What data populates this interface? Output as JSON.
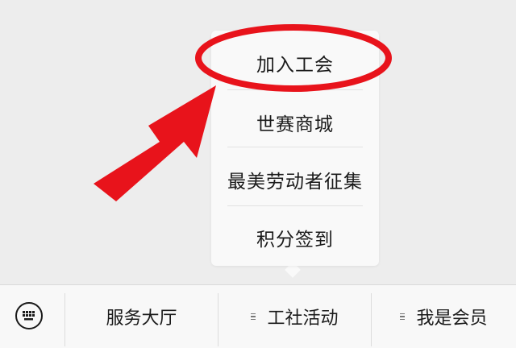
{
  "popup_menu": {
    "items": [
      {
        "label": "加入工会"
      },
      {
        "label": "世赛商城"
      },
      {
        "label": "最美劳动者征集"
      },
      {
        "label": "积分签到"
      }
    ]
  },
  "bottom_bar": {
    "keyboard_icon": "keyboard-icon",
    "tabs": [
      {
        "label": "服务大厅",
        "has_menu_icon": false
      },
      {
        "label": "工社活动",
        "has_menu_icon": true
      },
      {
        "label": "我是会员",
        "has_menu_icon": true
      }
    ]
  },
  "annotation": {
    "color": "#e8131b",
    "highlighted_item": "加入工会"
  },
  "colors": {
    "background": "#ededed",
    "menu_background": "#f9f9f9",
    "text": "#1a1a1a"
  }
}
